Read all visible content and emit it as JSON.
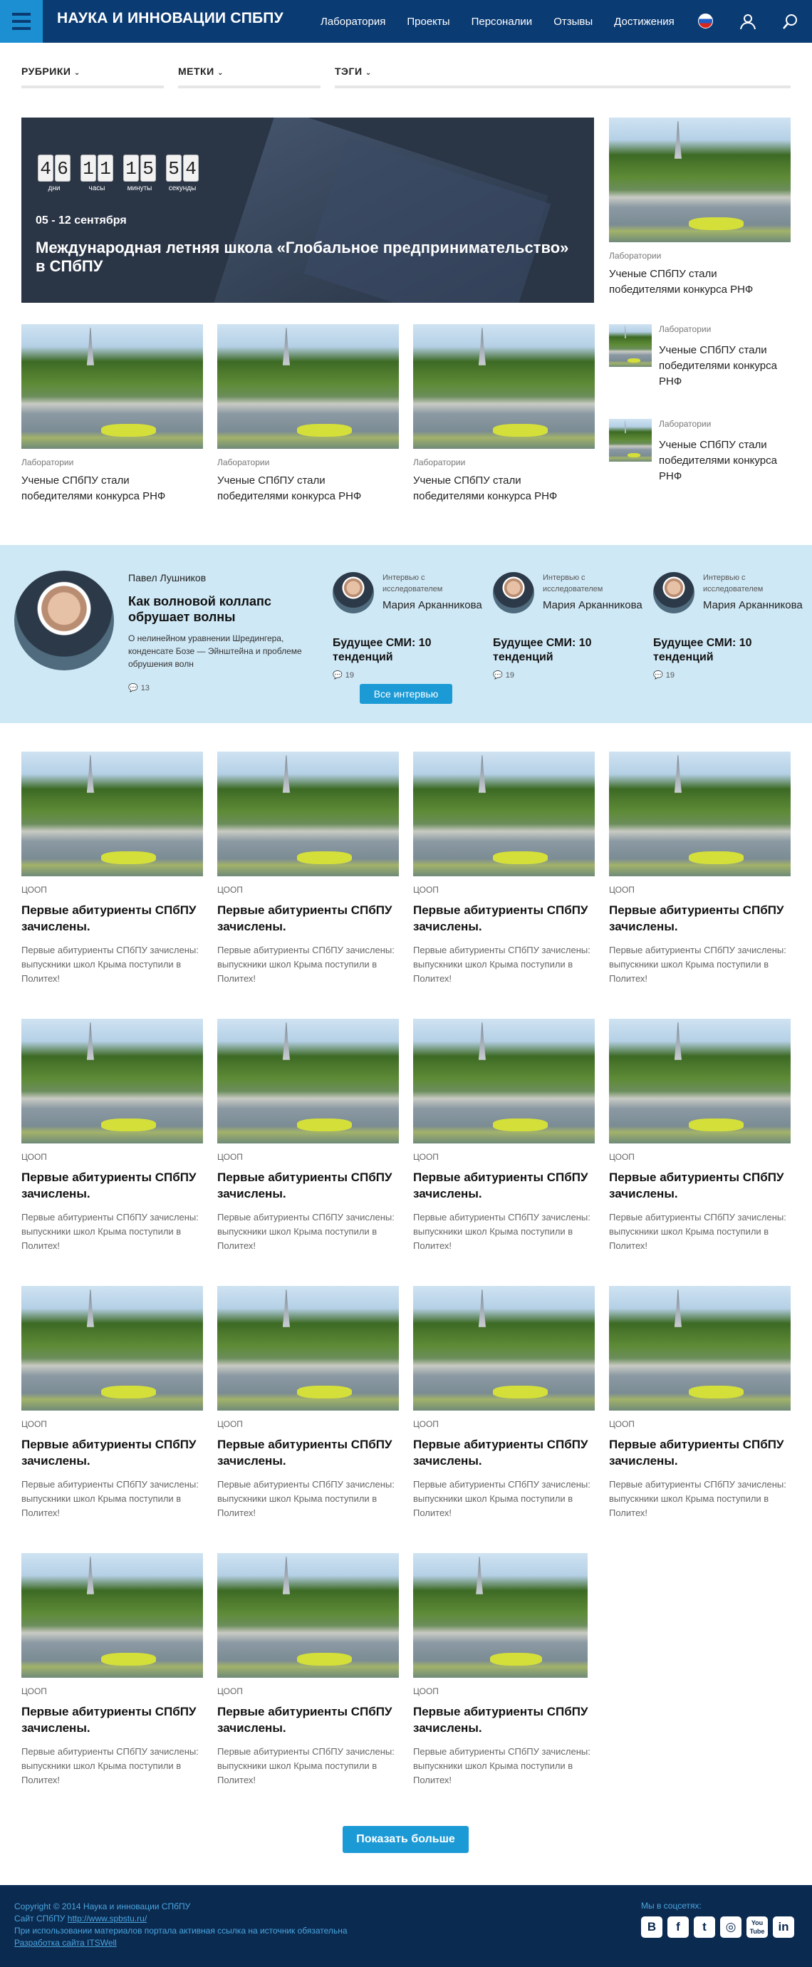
{
  "header": {
    "site_title": "НАУКА И ИННОВАЦИИ СПБПУ",
    "nav": [
      "Лаборатория",
      "Проекты",
      "Персоналии",
      "Отзывы",
      "Достижения"
    ]
  },
  "filters": [
    "РУБРИКИ",
    "МЕТКИ",
    "ТЭГИ"
  ],
  "hero": {
    "countdown": {
      "days": "46",
      "hours": "11",
      "minutes": "15",
      "seconds": "54",
      "labels": [
        "дни",
        "часы",
        "минуты",
        "секунды"
      ]
    },
    "date": "05 - 12 сентября",
    "title": "Международная летняя школа «Глобальное предпринимательство» в СПбПУ"
  },
  "side_top": {
    "category": "Лаборатории",
    "title": "Ученые СПбПУ стали победителями конкурса РНФ"
  },
  "row2": [
    {
      "category": "Лаборатории",
      "title": "Ученые СПбПУ стали победителями конкурса РНФ"
    },
    {
      "category": "Лаборатории",
      "title": "Ученые СПбПУ стали победителями конкурса РНФ"
    },
    {
      "category": "Лаборатории",
      "title": "Ученые СПбПУ стали победителями конкурса РНФ"
    }
  ],
  "mini_cards": [
    {
      "category": "Лаборатории",
      "title": "Ученые СПбПУ стали победителями конкурса РНФ"
    },
    {
      "category": "Лаборатории",
      "title": "Ученые СПбПУ стали победителями конкурса РНФ"
    }
  ],
  "interviews": {
    "main": {
      "name": "Павел Лушников",
      "title": "Как волновой коллапс обрушает волны",
      "description": "О нелинейном уравнении Шредингера, конденсате Бозе — Эйнштейна и проблеме обрушения волн",
      "comments": "13"
    },
    "items": [
      {
        "label": "Интервью с исследователем",
        "name": "Мария Арканникова",
        "title": "Будущее СМИ: 10 тенденций",
        "comments": "19"
      },
      {
        "label": "Интервью с исследователем",
        "name": "Мария Арканникова",
        "title": "Будущее СМИ: 10 тенденций",
        "comments": "19"
      },
      {
        "label": "Интервью с исследователем",
        "name": "Мария Арканникова",
        "title": "Будущее СМИ: 10 тенденций",
        "comments": "19"
      }
    ],
    "all_button": "Все интервью"
  },
  "grid": [
    {
      "category": "ЦООП",
      "title": "Первые абитуриенты СПбПУ зачислены.",
      "desc": "Первые абитуриенты СПбПУ зачислены: выпускники школ Крыма поступили в Политех!"
    },
    {
      "category": "ЦООП",
      "title": "Первые абитуриенты СПбПУ зачислены.",
      "desc": "Первые абитуриенты СПбПУ зачислены: выпускники школ Крыма поступили в Политех!"
    },
    {
      "category": "ЦООП",
      "title": "Первые абитуриенты СПбПУ зачислены.",
      "desc": "Первые абитуриенты СПбПУ зачислены: выпускники школ Крыма поступили в Политех!"
    },
    {
      "category": "ЦООП",
      "title": "Первые абитуриенты СПбПУ зачислены.",
      "desc": "Первые абитуриенты СПбПУ зачислены: выпускники школ Крыма поступили в Политех!"
    },
    {
      "category": "ЦООП",
      "title": "Первые абитуриенты СПбПУ зачислены.",
      "desc": "Первые абитуриенты СПбПУ зачислены: выпускники школ Крыма поступили в Политех!"
    },
    {
      "category": "ЦООП",
      "title": "Первые абитуриенты СПбПУ зачислены.",
      "desc": "Первые абитуриенты СПбПУ зачислены: выпускники школ Крыма поступили в Политех!"
    },
    {
      "category": "ЦООП",
      "title": "Первые абитуриенты СПбПУ зачислены.",
      "desc": "Первые абитуриенты СПбПУ зачислены: выпускники школ Крыма поступили в Политех!"
    },
    {
      "category": "ЦООП",
      "title": "Первые абитуриенты СПбПУ зачислены.",
      "desc": "Первые абитуриенты СПбПУ зачислены: выпускники школ Крыма поступили в Политех!"
    },
    {
      "category": "ЦООП",
      "title": "Первые абитуриенты СПбПУ зачислены.",
      "desc": "Первые абитуриенты СПбПУ зачислены: выпускники школ Крыма поступили в Политех!"
    },
    {
      "category": "ЦООП",
      "title": "Первые абитуриенты СПбПУ зачислены.",
      "desc": "Первые абитуриенты СПбПУ зачислены: выпускники школ Крыма поступили в Политех!"
    },
    {
      "category": "ЦООП",
      "title": "Первые абитуриенты СПбПУ зачислены.",
      "desc": "Первые абитуриенты СПбПУ зачислены: выпускники школ Крыма поступили в Политех!"
    },
    {
      "category": "ЦООП",
      "title": "Первые абитуриенты СПбПУ зачислены.",
      "desc": "Первые абитуриенты СПбПУ зачислены: выпускники школ Крыма поступили в Политех!"
    },
    {
      "category": "ЦООП",
      "title": "Первые абитуриенты СПбПУ зачислены.",
      "desc": "Первые абитуриенты СПбПУ зачислены: выпускники школ Крыма поступили в Политех!"
    },
    {
      "category": "ЦООП",
      "title": "Первые абитуриенты СПбПУ зачислены.",
      "desc": "Первые абитуриенты СПбПУ зачислены: выпускники школ Крыма поступили в Политех!"
    },
    {
      "category": "ЦООП",
      "title": "Первые абитуриенты СПбПУ зачислены.",
      "desc": "Первые абитуриенты СПбПУ зачислены: выпускники школ Крыма поступили в Политех!"
    }
  ],
  "more_button": "Показать больше",
  "footer": {
    "copyright": "Copyright © 2014 Наука и инновации СПбПУ",
    "site_label": "Сайт СПбПУ",
    "site_url": "http://www.spbstu.ru/",
    "notice": "При использовании материалов портала активная ссылка на источник обязательна",
    "dev": "Разработка сайта ITSWell",
    "social_label": "Мы в соцсетях:",
    "socials": [
      "В",
      "f",
      "t",
      "◎",
      "You Tube",
      "in"
    ]
  },
  "colors": {
    "header": "#0b3b73",
    "accent": "#1b9ad6",
    "band": "#cfe8f5",
    "footer": "#0b2a50"
  }
}
